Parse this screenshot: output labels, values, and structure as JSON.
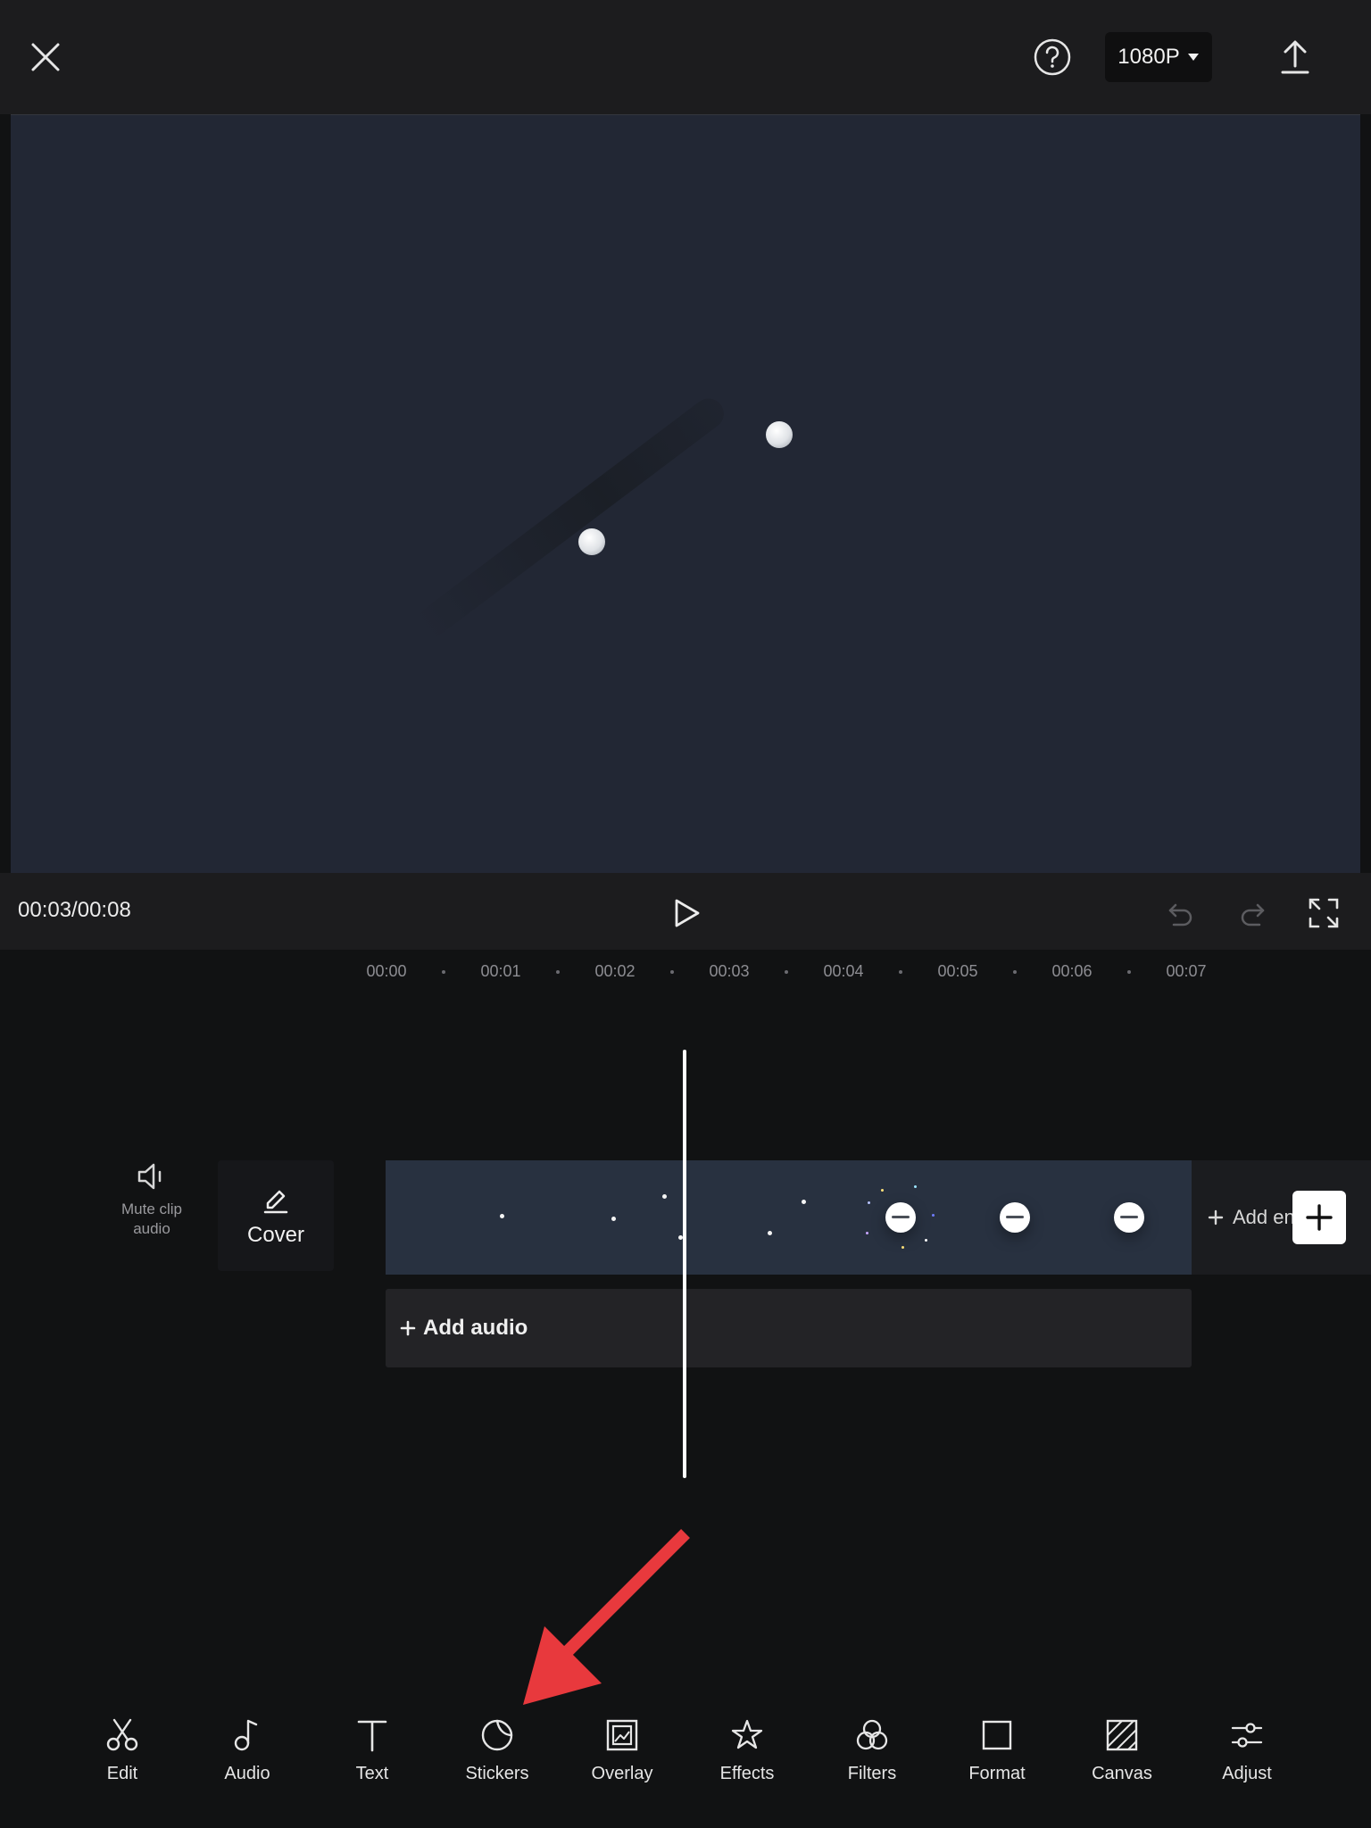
{
  "header": {
    "resolution_label": "1080P"
  },
  "player": {
    "timecode": "00:03/00:08"
  },
  "ruler": {
    "ticks": [
      "00:00",
      "00:01",
      "00:02",
      "00:03",
      "00:04",
      "00:05",
      "00:06",
      "00:07"
    ]
  },
  "timeline": {
    "mute_label": "Mute clip audio",
    "cover_label": "Cover",
    "add_ending_label": "Add ending",
    "add_audio_label": "Add audio"
  },
  "toolbar": {
    "items": [
      {
        "label": "Edit",
        "icon": "scissors-icon"
      },
      {
        "label": "Audio",
        "icon": "music-note-icon"
      },
      {
        "label": "Text",
        "icon": "text-icon"
      },
      {
        "label": "Stickers",
        "icon": "sticker-icon"
      },
      {
        "label": "Overlay",
        "icon": "overlay-icon"
      },
      {
        "label": "Effects",
        "icon": "star-icon"
      },
      {
        "label": "Filters",
        "icon": "filters-icon"
      },
      {
        "label": "Format",
        "icon": "square-icon"
      },
      {
        "label": "Canvas",
        "icon": "canvas-icon"
      },
      {
        "label": "Adjust",
        "icon": "sliders-icon"
      }
    ]
  },
  "colors": {
    "background": "#111213",
    "panel": "#1c1c1e",
    "preview": "#222734",
    "annotation_arrow": "#e8393d"
  }
}
